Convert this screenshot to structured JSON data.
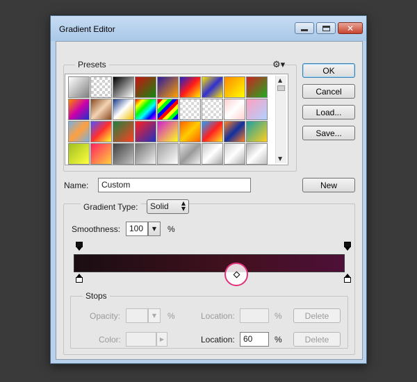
{
  "window": {
    "title": "Gradient Editor"
  },
  "presets": {
    "legend": "Presets",
    "menu_icon": "gear-icon",
    "swatches": [
      "linear-gradient(135deg,#ffffff,#808080)",
      "repeating-conic-gradient(#d0d0d0 0 25%,#ffffff 0 50%) 0 0/8px 8px",
      "linear-gradient(135deg,#000,#fff)",
      "linear-gradient(135deg,#cc1111,#118811)",
      "linear-gradient(135deg,#2a1aa0,#ffa000)",
      "linear-gradient(135deg,#1a22cc,#ff1a1a,#ffee00)",
      "linear-gradient(135deg,#ffe600,#3030d0,#ffe600)",
      "linear-gradient(135deg,#ff8800,#ffff00)",
      "linear-gradient(135deg,#cc2222,#22aa22)",
      "linear-gradient(135deg,#ff8800,#cc00aa,#2030cc)",
      "linear-gradient(135deg,#8a4b24,#f3d3b3,#8a4b24)",
      "linear-gradient(135deg,#1a3a8a,#ffffff,#f0c000)",
      "linear-gradient(135deg,#ff0000,#ffff00,#00ff00,#00ffff,#0000ff,#ff00ff)",
      "repeating-linear-gradient(135deg,#ff0000 0 5px,#ffff00 5px 10px,#00ff00 10px 15px,#0000ff 15px 20px)",
      "repeating-conic-gradient(#d8d8d8 0 25%,#ffffff 0 50%) 0 0/8px 8px",
      "repeating-conic-gradient(#d8d8d8 0 25%,#ffffff 0 50%) 0 0/8px 8px",
      "linear-gradient(135deg,#ffd0d0,#ffffff,#ffd0d0)",
      "linear-gradient(135deg,#ffa0c0,#b0d0ff)",
      "linear-gradient(135deg,#7ab0e0,#ffa040,#7ab0e0)",
      "linear-gradient(135deg,#5050ff,#ff3030,#ffff30)",
      "linear-gradient(135deg,#208040,#ff4020)",
      "linear-gradient(135deg,#ff2020,#2030c0)",
      "linear-gradient(135deg,#d020d0,#ffff20)",
      "linear-gradient(135deg,#ff6000,#ffcc00,#ff6000)",
      "linear-gradient(135deg,#20a0ff,#ff2020,#ffe020)",
      "linear-gradient(135deg,#ff8020,#1030a0,#ff8020)",
      "linear-gradient(135deg,#20a0a0,#ffd020)",
      "linear-gradient(135deg,#a0c020,#ffff40)",
      "linear-gradient(135deg,#ff2060,#ffd040)",
      "linear-gradient(135deg,#404040,#c0c0c0)",
      "linear-gradient(135deg,#707070,#f0f0f0)",
      "linear-gradient(135deg,#a0a0a0,#ffffff)",
      "linear-gradient(135deg,#e0e0e0,#9a9a9a,#f0f0f0)",
      "linear-gradient(135deg,#c8c8c8,#ffffff,#a8a8a8)",
      "linear-gradient(135deg,#d0d0d0,#ffffff,#b0b0b0)",
      "linear-gradient(135deg,#b0b0b0,#ffffff,#c0c0c0)"
    ]
  },
  "buttons": {
    "ok": "OK",
    "cancel": "Cancel",
    "load": "Load...",
    "save": "Save...",
    "new": "New"
  },
  "name": {
    "label": "Name:",
    "value": "Custom"
  },
  "gradient_type": {
    "label": "Gradient Type:",
    "value": "Solid"
  },
  "smoothness": {
    "label": "Smoothness:",
    "value": "100",
    "unit": "%"
  },
  "gradient": {
    "colors": [
      "#1a0e12",
      "#43101f",
      "#4e1038"
    ],
    "midpoint_location_percent": 60,
    "opacity_stops": [
      "#000000",
      "#000000"
    ],
    "color_stops": [
      "#1a0e12",
      "#4e1038"
    ]
  },
  "stops": {
    "legend": "Stops",
    "opacity_label": "Opacity:",
    "opacity_value": "",
    "opacity_unit": "%",
    "location_label_top": "Location:",
    "location_top_value": "",
    "location_top_unit": "%",
    "delete_top": "Delete",
    "color_label": "Color:",
    "location_label_bottom": "Location:",
    "location_bottom_value": "60",
    "location_bottom_unit": "%",
    "delete_bottom": "Delete"
  }
}
